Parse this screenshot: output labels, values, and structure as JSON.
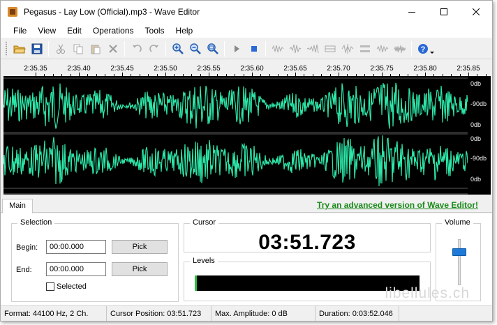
{
  "window": {
    "title": "Pegasus - Lay Low (Official).mp3 - Wave Editor"
  },
  "menu": [
    "File",
    "View",
    "Edit",
    "Operations",
    "Tools",
    "Help"
  ],
  "toolbar_icons": [
    "open-icon",
    "save-icon",
    "cut-icon",
    "copy-icon",
    "paste-icon",
    "delete-icon",
    "undo-icon",
    "redo-icon",
    "zoom-in-icon",
    "zoom-out-icon",
    "zoom-fit-icon",
    "play-icon",
    "stop-icon",
    "normalize-icon",
    "amplify-icon",
    "fade-icon",
    "echo-icon",
    "reverse-icon",
    "silence-icon",
    "invert-icon",
    "noise-icon",
    "help-icon"
  ],
  "ruler": {
    "labels": [
      "2:35.35",
      "2:35.40",
      "2:35.45",
      "2:35.50",
      "2:35.55",
      "2:35.60",
      "2:35.65",
      "2:35.70",
      "2:35.75",
      "2:35.80",
      "2:35.85"
    ]
  },
  "waveform": {
    "color": "#2de8a8",
    "channels": 2,
    "db_labels": [
      "0db",
      "-90db",
      "0db",
      "0db",
      "-90db",
      "0db"
    ]
  },
  "tabs": {
    "main": "Main"
  },
  "promo": {
    "link": "Try an advanced version of Wave Editor!"
  },
  "selection": {
    "title": "Selection",
    "begin_label": "Begin:",
    "begin_value": "00:00.000",
    "end_label": "End:",
    "end_value": "00:00.000",
    "pick_label": "Pick",
    "selected_label": "Selected"
  },
  "cursor": {
    "title": "Cursor",
    "value": "03:51.723"
  },
  "levels": {
    "title": "Levels",
    "fill_fraction": 0.01,
    "fill_color": "#2bbf3f"
  },
  "volume": {
    "title": "Volume",
    "level_fraction": 0.72
  },
  "watermark": "libellules.ch",
  "status": {
    "format": "Format: 44100 Hz, 2 Ch.",
    "cursor_position": "Cursor Position: 03:51.723",
    "max_amplitude": "Max. Amplitude: 0 dB",
    "duration": "Duration: 0:03:52.046"
  }
}
